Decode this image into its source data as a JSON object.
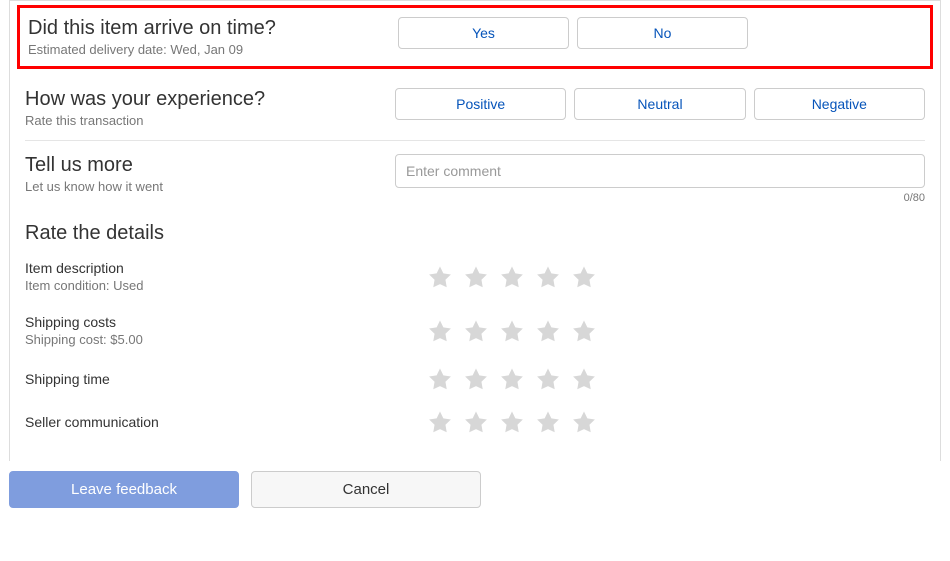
{
  "arrive": {
    "title": "Did this item arrive on time?",
    "sub": "Estimated delivery date: Wed, Jan 09",
    "yes": "Yes",
    "no": "No"
  },
  "experience": {
    "title": "How was your experience?",
    "sub": "Rate this transaction",
    "positive": "Positive",
    "neutral": "Neutral",
    "negative": "Negative"
  },
  "tellmore": {
    "title": "Tell us more",
    "sub": "Let us know how it went",
    "placeholder": "Enter comment",
    "count": "0/80"
  },
  "details": {
    "title": "Rate the details",
    "rows": [
      {
        "label": "Item description",
        "sub": "Item condition: Used"
      },
      {
        "label": "Shipping costs",
        "sub": "Shipping cost: $5.00"
      },
      {
        "label": "Shipping time",
        "sub": ""
      },
      {
        "label": "Seller communication",
        "sub": ""
      }
    ]
  },
  "actions": {
    "leave": "Leave feedback",
    "cancel": "Cancel"
  }
}
